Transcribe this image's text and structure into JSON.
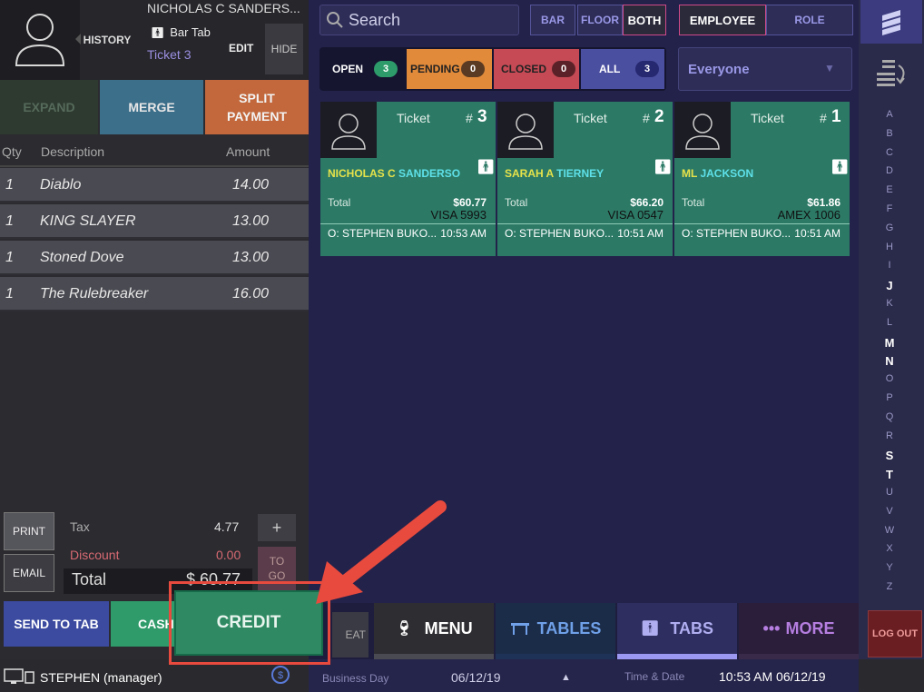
{
  "customer": {
    "name": "NICHOLAS C SANDERS...",
    "tab_type": "Bar Tab",
    "ticket": "Ticket 3",
    "history_label": "HISTORY",
    "edit_label": "EDIT",
    "hide_label": "HIDE"
  },
  "order_actions": {
    "expand": "EXPAND",
    "merge": "MERGE",
    "split_line1": "SPLIT",
    "split_line2": "PAYMENT"
  },
  "order_table": {
    "headers": [
      "Qty",
      "Description",
      "Amount"
    ],
    "rows": [
      {
        "qty": "1",
        "desc": "Diablo",
        "amount": "14.00"
      },
      {
        "qty": "1",
        "desc": "KING SLAYER",
        "amount": "13.00"
      },
      {
        "qty": "1",
        "desc": "Stoned Dove",
        "amount": "13.00"
      },
      {
        "qty": "1",
        "desc": "The Rulebreaker",
        "amount": "16.00"
      }
    ]
  },
  "totals": {
    "tax_label": "Tax",
    "tax": "4.77",
    "discount_label": "Discount",
    "discount": "0.00",
    "total_label": "Total",
    "total": "$ 60.77"
  },
  "side_buttons": {
    "print": "PRINT",
    "email": "EMAIL",
    "plus": "+",
    "togo_line1": "TO",
    "togo_line2": "GO"
  },
  "payment_buttons": {
    "send_to_tab": "SEND TO TAB",
    "cash": "CASH",
    "credit": "CREDIT"
  },
  "search": {
    "placeholder": "Search"
  },
  "area_filter": [
    "BAR",
    "FLOOR",
    "BOTH"
  ],
  "area_selected": "BOTH",
  "group_filter": [
    "EMPLOYEE",
    "ROLE"
  ],
  "group_selected": "EMPLOYEE",
  "status_filters": [
    {
      "label": "OPEN",
      "count": "3"
    },
    {
      "label": "PENDING",
      "count": "0"
    },
    {
      "label": "CLOSED",
      "count": "0"
    },
    {
      "label": "ALL",
      "count": "3"
    }
  ],
  "employee_dropdown": "Everyone",
  "tickets": [
    {
      "number": "3",
      "label": "Ticket",
      "first": "NICHOLAS C",
      "last": "SANDERSO",
      "total_label": "Total",
      "total": "$60.77",
      "payment": "VISA 5993",
      "server": "O: STEPHEN BUKO...",
      "time": "10:53 AM"
    },
    {
      "number": "2",
      "label": "Ticket",
      "first": "SARAH A",
      "last": "TIERNEY",
      "total_label": "Total",
      "total": "$66.20",
      "payment": "VISA 0547",
      "server": "O: STEPHEN BUKO...",
      "time": "10:51 AM"
    },
    {
      "number": "1",
      "label": "Ticket",
      "first": "ML",
      "last": "JACKSON",
      "total_label": "Total",
      "total": "$61.86",
      "payment": "AMEX 1006",
      "server": "O: STEPHEN BUKO...",
      "time": "10:51 AM"
    }
  ],
  "alphabet": [
    "A",
    "B",
    "C",
    "D",
    "E",
    "F",
    "G",
    "H",
    "I",
    "J",
    "K",
    "L",
    "M",
    "N",
    "O",
    "P",
    "Q",
    "R",
    "S",
    "T",
    "U",
    "V",
    "W",
    "X",
    "Y",
    "Z"
  ],
  "alphabet_bold": [
    "J",
    "M",
    "N",
    "S",
    "T"
  ],
  "bottom_nav": {
    "repeat": "EAT",
    "menu": "MENU",
    "tables": "TABLES",
    "tabs": "TABS",
    "more": "MORE",
    "logout": "LOG OUT"
  },
  "footer": {
    "user": "STEPHEN (manager)",
    "business_day_label": "Business Day",
    "business_day": "06/12/19",
    "time_date_label": "Time & Date",
    "time_date": "10:53 AM 06/12/19"
  },
  "colors": {
    "credit": "#2f8a63",
    "highlight": "#e84a3e",
    "ticket_card": "#2c7a66",
    "accent_pink": "#d04a8a"
  }
}
